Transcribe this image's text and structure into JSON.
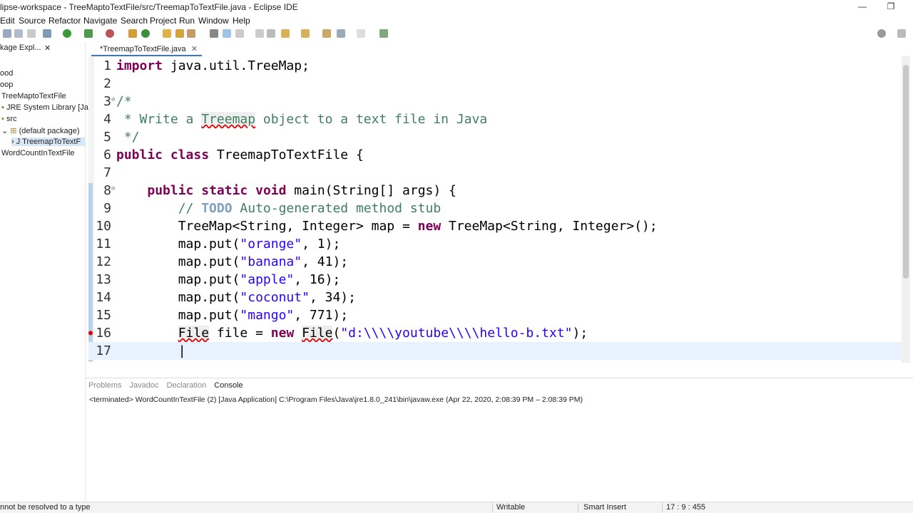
{
  "window": {
    "title": "lipse-workspace - TreeMaptoTextFile/src/TreemapToTextFile.java - Eclipse IDE",
    "minimize": "—",
    "restore": "❐"
  },
  "menu": [
    "Edit",
    "Source",
    "Refactor",
    "Navigate",
    "Search",
    "Project",
    "Run",
    "Window",
    "Help"
  ],
  "explorer": {
    "tab_label": "kage Expl...",
    "close": "✕",
    "items": [
      {
        "label": "ood"
      },
      {
        "label": "oop"
      },
      {
        "label": "TreeMaptoTextFile"
      },
      {
        "label": "JRE System Library [Ja"
      },
      {
        "label": "src"
      },
      {
        "label": "(default package)"
      },
      {
        "label": "TreemapToTextF"
      },
      {
        "label": "WordCountInTextFile"
      }
    ]
  },
  "editor": {
    "tab_label": "*TreemapToTextFile.java",
    "close": "✕",
    "lines": [
      {
        "num": "1",
        "text": "import java.util.TreeMap;"
      },
      {
        "num": "2",
        "text": ""
      },
      {
        "num": "3",
        "text": "/*"
      },
      {
        "num": "4",
        "text": " * Write a Treemap object to a text file in Java"
      },
      {
        "num": "5",
        "text": " */"
      },
      {
        "num": "6",
        "text": "public class TreemapToTextFile {"
      },
      {
        "num": "7",
        "text": ""
      },
      {
        "num": "8",
        "text": "    public static void main(String[] args) {"
      },
      {
        "num": "9",
        "text": "        // TODO Auto-generated method stub"
      },
      {
        "num": "10",
        "text": "        TreeMap<String, Integer> map = new TreeMap<String, Integer>();"
      },
      {
        "num": "11",
        "text": "        map.put(\"orange\", 1);"
      },
      {
        "num": "12",
        "text": "        map.put(\"banana\", 41);"
      },
      {
        "num": "13",
        "text": "        map.put(\"apple\", 16);"
      },
      {
        "num": "14",
        "text": "        map.put(\"coconut\", 34);"
      },
      {
        "num": "15",
        "text": "        map.put(\"mango\", 771);"
      },
      {
        "num": "16",
        "text": "        File file = new File(\"d:\\\\youtube\\\\hello-b.txt\");"
      },
      {
        "num": "17",
        "text": ""
      }
    ]
  },
  "console": {
    "tabs": [
      "Problems",
      "Javadoc",
      "Declaration",
      "Console"
    ],
    "active_tab": "Console",
    "info": "<terminated> WordCountInTextFile (2) [Java Application] C:\\Program Files\\Java\\jre1.8.0_241\\bin\\javaw.exe  (Apr 22, 2020, 2:08:39 PM – 2:08:39 PM)"
  },
  "status": {
    "message": "nnot be resolved to a type",
    "mode": "Writable",
    "insert": "Smart Insert",
    "position": "17 : 9 : 455"
  },
  "colors": {
    "keyword": "#7f0055",
    "comment": "#3f7f5f",
    "string": "#2a00ff",
    "current_line": "#e8f2fe"
  }
}
